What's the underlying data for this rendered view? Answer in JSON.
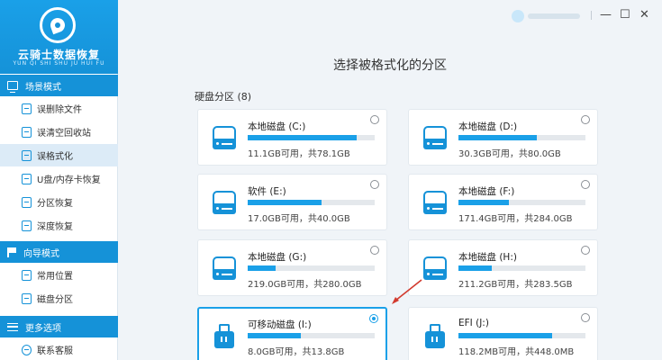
{
  "app": {
    "name": "云骑士数据恢复",
    "subtitle": "YUN QI SHI SHU JU HUI FU"
  },
  "sidebar": {
    "sections": [
      {
        "title": "场景模式",
        "items": [
          {
            "label": "误删除文件"
          },
          {
            "label": "误清空回收站"
          },
          {
            "label": "误格式化"
          },
          {
            "label": "U盘/内存卡恢复"
          },
          {
            "label": "分区恢复"
          },
          {
            "label": "深度恢复"
          }
        ]
      },
      {
        "title": "向导模式",
        "items": [
          {
            "label": "常用位置"
          },
          {
            "label": "磁盘分区"
          }
        ]
      },
      {
        "title": "更多选项",
        "items": [
          {
            "label": "联系客服"
          }
        ]
      }
    ],
    "active_item": "误格式化"
  },
  "window_controls": {
    "minimize": "—",
    "maximize": "☐",
    "close": "✕"
  },
  "main": {
    "title": "选择被格式化的分区",
    "group_label": "硬盘分区 (8)",
    "partitions": [
      {
        "name": "本地磁盘 (C:)",
        "capacity": "11.1GB可用，共78.1GB",
        "used_fraction": 0.86,
        "icon": "hdd-icon",
        "selected": false
      },
      {
        "name": "本地磁盘 (D:)",
        "capacity": "30.3GB可用，共80.0GB",
        "used_fraction": 0.62,
        "icon": "hdd-icon",
        "selected": false
      },
      {
        "name": "软件 (E:)",
        "capacity": "17.0GB可用，共40.0GB",
        "used_fraction": 0.58,
        "icon": "hdd-icon",
        "selected": false
      },
      {
        "name": "本地磁盘 (F:)",
        "capacity": "171.4GB可用，共284.0GB",
        "used_fraction": 0.4,
        "icon": "hdd-icon",
        "selected": false
      },
      {
        "name": "本地磁盘 (G:)",
        "capacity": "219.0GB可用，共280.0GB",
        "used_fraction": 0.22,
        "icon": "hdd-icon",
        "selected": false
      },
      {
        "name": "本地磁盘 (H:)",
        "capacity": "211.2GB可用，共283.5GB",
        "used_fraction": 0.26,
        "icon": "hdd-icon",
        "selected": false
      },
      {
        "name": "可移动磁盘 (I:)",
        "capacity": "8.0GB可用，共13.8GB",
        "used_fraction": 0.42,
        "icon": "usb-drive-icon",
        "selected": true
      },
      {
        "name": "EFI (J:)",
        "capacity": "118.2MB可用，共448.0MB",
        "used_fraction": 0.74,
        "icon": "usb-drive-icon",
        "selected": false
      }
    ]
  },
  "colors": {
    "accent": "#1aa0e8",
    "sidebar_header": "#1592d8",
    "annotation_arrow": "#d23a2e"
  }
}
